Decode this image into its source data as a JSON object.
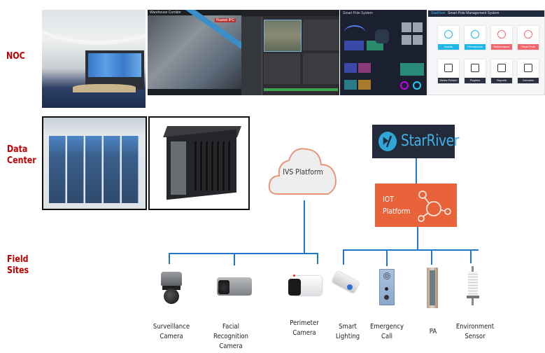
{
  "tiers": {
    "noc": "NOC",
    "data_center_line1": "Data",
    "data_center_line2": "Center",
    "field_sites_line1": "Field",
    "field_sites_line2": "Sites"
  },
  "noc_screens": {
    "video_title": "Warehouse Corridor",
    "video_overlay": "Huawei IPC",
    "dashboard_title": "Smart Pole System",
    "mgmt_brand": "StarRiver",
    "mgmt_title": "Smart Pole Management System",
    "mgmt_tiles": [
      {
        "label": "Assets",
        "color": "#1fb6e8"
      },
      {
        "label": "Permissions",
        "color": "#1fb6e8"
      },
      {
        "label": "Maintenance",
        "color": "#f0686e"
      },
      {
        "label": "Smart Pole",
        "color": "#f0686e"
      },
      {
        "label": "Media Publish",
        "color": "#2d3142"
      },
      {
        "label": "Playlists",
        "color": "#2d3142"
      },
      {
        "label": "Reports",
        "color": "#2d3142"
      },
      {
        "label": "Domains",
        "color": "#2d3142"
      }
    ]
  },
  "platforms": {
    "starriver": "StarRiver",
    "iot_line1": "IOT",
    "iot_line2": "Platform",
    "ivs": "IVS Platform"
  },
  "devices": [
    {
      "line1": "Surveillance",
      "line2": "Camera"
    },
    {
      "line1": "Facial Recognition",
      "line2": "Camera"
    },
    {
      "line1": "Perimeter",
      "line2": "Camera"
    },
    {
      "line1": "Smart",
      "line2": "Lighting"
    },
    {
      "line1": "Emergency",
      "line2": "Call"
    },
    {
      "line1": "PA",
      "line2": ""
    },
    {
      "line1": "Environment",
      "line2": "Sensor"
    }
  ],
  "colors": {
    "tier_label": "#c00000",
    "connector": "#1f77c9",
    "iot_platform": "#e8633a",
    "starriver_bg": "#232a3a",
    "starriver_text": "#3fb2e6"
  }
}
